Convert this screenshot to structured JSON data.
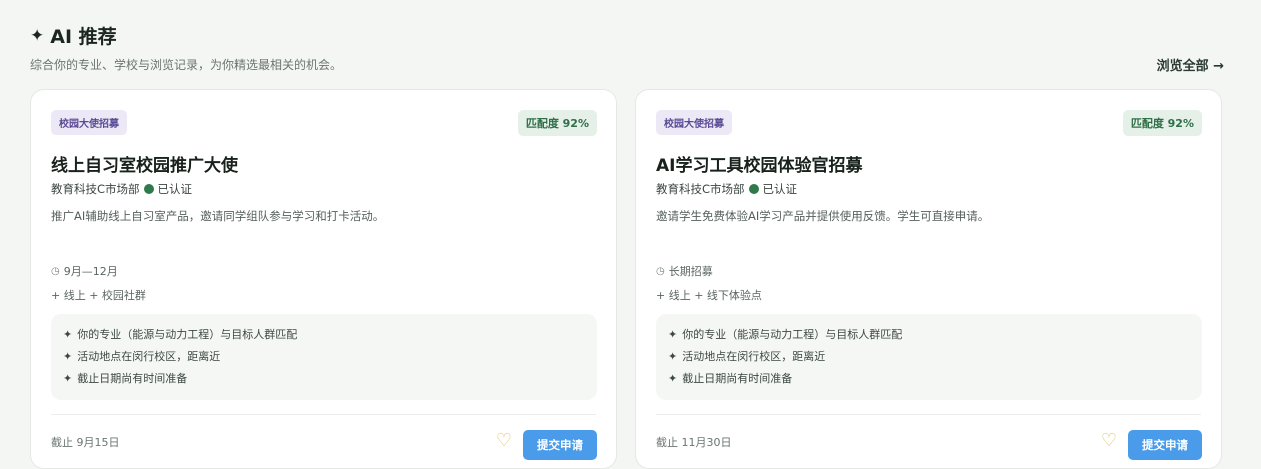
{
  "header": {
    "title": "AI 推荐",
    "subtitle": "综合你的专业、学校与浏览记录，为你精选最相关的机会。",
    "browse_all": "浏览全部 →"
  },
  "cards": [
    {
      "tag": "校园大使招募",
      "match": "匹配度 92%",
      "title": "线上自习室校园推广大使",
      "org": "教育科技C市场部",
      "verified": "已认证",
      "desc": "推广AI辅助线上自习室产品，邀请同学组队参与学习和打卡活动。",
      "time": "9月—12月",
      "places": "+ 线上 + 校园社群",
      "reasons": [
        "你的专业（能源与动力工程）与目标人群匹配",
        "活动地点在闵行校区，距离近",
        "截止日期尚有时间准备"
      ],
      "deadline": "截止 9月15日",
      "apply": "提交申请"
    },
    {
      "tag": "校园大使招募",
      "match": "匹配度 92%",
      "title": "AI学习工具校园体验官招募",
      "org": "教育科技C市场部",
      "verified": "已认证",
      "desc": "邀请学生免费体验AI学习产品并提供使用反馈。学生可直接申请。",
      "time": "长期招募",
      "places": "+ 线上 + 线下体验点",
      "reasons": [
        "你的专业（能源与动力工程）与目标人群匹配",
        "活动地点在闵行校区，距离近",
        "截止日期尚有时间准备"
      ],
      "deadline": "截止 11月30日",
      "apply": "提交申请"
    }
  ]
}
